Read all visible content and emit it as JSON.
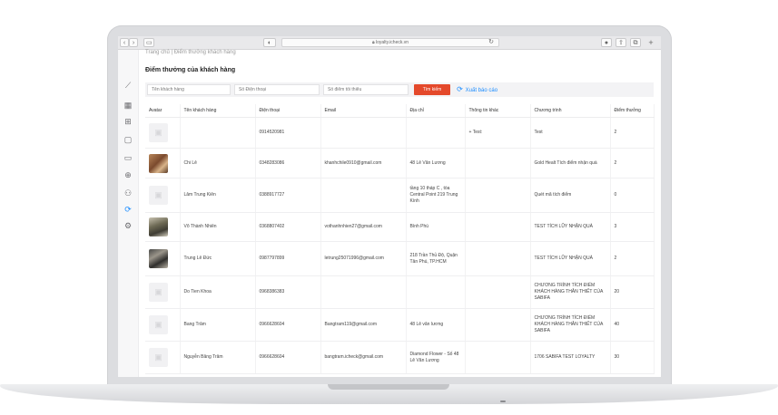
{
  "browser": {
    "url": "loyalty.icheck.vn"
  },
  "breadcrumb": {
    "home": "Trang chủ",
    "separator": "|",
    "current": "Điểm thưởng khách hàng"
  },
  "page": {
    "title": "Điểm thưởng của khách hàng"
  },
  "filters": {
    "name_placeholder": "Tên khách hàng",
    "phone_placeholder": "Số Điện thoại",
    "min_points_placeholder": "Số điểm tối thiểu",
    "search_label": "Tìm kiếm",
    "export_label": "Xuất báo cáo"
  },
  "colors": {
    "accent": "#1a8cff",
    "search_button": "#e4492b"
  },
  "table": {
    "headers": [
      "Avatar",
      "Tên khách hàng",
      "Điện thoại",
      "Email",
      "Địa chỉ",
      "Thông tin khác",
      "Chương trình",
      "Điểm thưởng"
    ],
    "rows": [
      {
        "avatar": "placeholder",
        "name": "",
        "phone": "0914520981",
        "email": "",
        "address": "",
        "other": "+ Test:",
        "program": "Test",
        "points": "2"
      },
      {
        "avatar": "cat",
        "name": "Chi Lê",
        "phone": "0348283086",
        "email": "khanhchile0910@gmail.com",
        "address": "48 Lê Văn Lương",
        "other": "",
        "program": "Gold Healt Tích điểm nhận quà",
        "points": "2"
      },
      {
        "avatar": "placeholder",
        "name": "Lâm Trung Kiên",
        "phone": "0388917727",
        "email": "",
        "address": "tầng 10 tháp C , tòa Central Point 219 Trung Kính",
        "other": "",
        "program": "Quét mã tích điểm",
        "points": "0"
      },
      {
        "avatar": "person1",
        "name": "Võ Thành Nhiên",
        "phone": "0368807402",
        "email": "vothanhnhien27@gmail.com",
        "address": "Bình Phú",
        "other": "",
        "program": "TEST TÍCH LŨY NHẬN QUÀ",
        "points": "3"
      },
      {
        "avatar": "person2",
        "name": "Trung Lê Đức",
        "phone": "0987797899",
        "email": "letrung25071996@gmail.com",
        "address": "218 Trần Thủ Độ, Quận Tân Phú, TP.HCM",
        "other": "",
        "program": "TEST TÍCH LŨY NHẬN QUÀ",
        "points": "2"
      },
      {
        "avatar": "placeholder",
        "name": "Do Tien Khoa",
        "phone": "0968386383",
        "email": "",
        "address": "",
        "other": "",
        "program": "CHƯƠNG TRÌNH TÍCH ĐIỂM KHÁCH HÀNG THÂN THIẾT CỦA SABIFA",
        "points": "20"
      },
      {
        "avatar": "placeholder",
        "name": "Bang Trâm",
        "phone": "0966628604",
        "email": "Bangtram119@gmail.com",
        "address": "48 Lê văn lương",
        "other": "",
        "program": "CHƯƠNG TRÌNH TÍCH ĐIỂM KHÁCH HÀNG THÂN THIẾT CỦA SABIFA",
        "points": "40"
      },
      {
        "avatar": "placeholder",
        "name": "Nguyễn Băng Trâm",
        "phone": "0966628604",
        "email": "bangtram.icheck@gmail.com",
        "address": "Diamond Flower - Số 48 Lê Văn Lương",
        "other": "",
        "program": "1706 SABIFA TEST LOYALTY",
        "points": "30"
      }
    ]
  }
}
